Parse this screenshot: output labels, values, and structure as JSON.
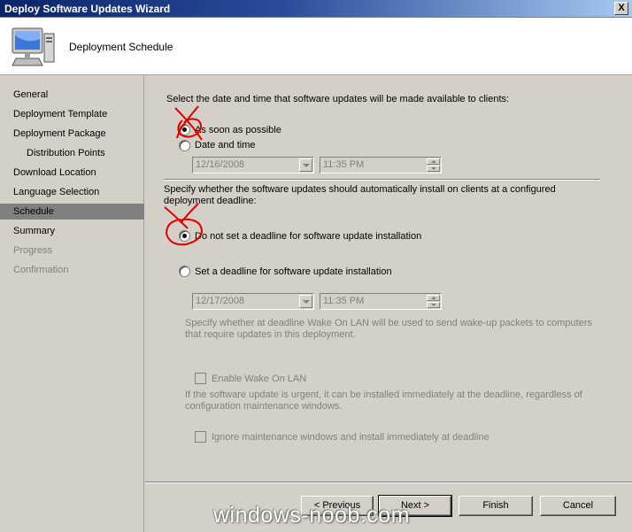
{
  "window": {
    "title": "Deploy Software Updates Wizard",
    "close_label": "X"
  },
  "header": {
    "title": "Deployment Schedule",
    "icon": "computer-icon"
  },
  "nav": {
    "items": [
      {
        "label": "General",
        "state": "normal"
      },
      {
        "label": "Deployment Template",
        "state": "normal"
      },
      {
        "label": "Deployment Package",
        "state": "normal"
      },
      {
        "label": "Distribution Points",
        "state": "normal"
      },
      {
        "label": "Download Location",
        "state": "normal"
      },
      {
        "label": "Language Selection",
        "state": "normal"
      },
      {
        "label": "Schedule",
        "state": "selected"
      },
      {
        "label": "Summary",
        "state": "normal"
      },
      {
        "label": "Progress",
        "state": "disabled"
      },
      {
        "label": "Confirmation",
        "state": "disabled"
      }
    ]
  },
  "schedule": {
    "prompt": "Select the date and time that software updates will be made available to clients:",
    "asap_label": "As soon as possible",
    "datetime_label": "Date and time",
    "selected": "asap",
    "avail_date": "12/16/2008",
    "avail_time": "11:35 PM"
  },
  "deadline": {
    "prompt": "Specify whether the software updates should automatically install on clients at a configured deployment deadline:",
    "no_deadline_label": "Do not set a deadline for software update installation",
    "set_deadline_label": "Set a deadline for software update installation",
    "selected": "no_deadline",
    "deadline_date": "12/17/2008",
    "deadline_time": "11:35 PM",
    "wol_desc": "Specify whether at deadline Wake On LAN will be used to send wake-up packets to computers that require updates in this deployment.",
    "wol_label": "Enable Wake On LAN",
    "urgent_desc": "If the software update is urgent, it can be installed immediately at the deadline, regardless of configuration maintenance windows.",
    "ignore_mw_label": "Ignore maintenance windows and install immediately at deadline"
  },
  "footer": {
    "previous": "< Previous",
    "next": "Next >",
    "finish": "Finish",
    "cancel": "Cancel"
  },
  "watermark": "windows-noob.com",
  "colors": {
    "title_bar": "#0a246a",
    "annotation": "#e00000",
    "disabled_text": "#808080"
  }
}
